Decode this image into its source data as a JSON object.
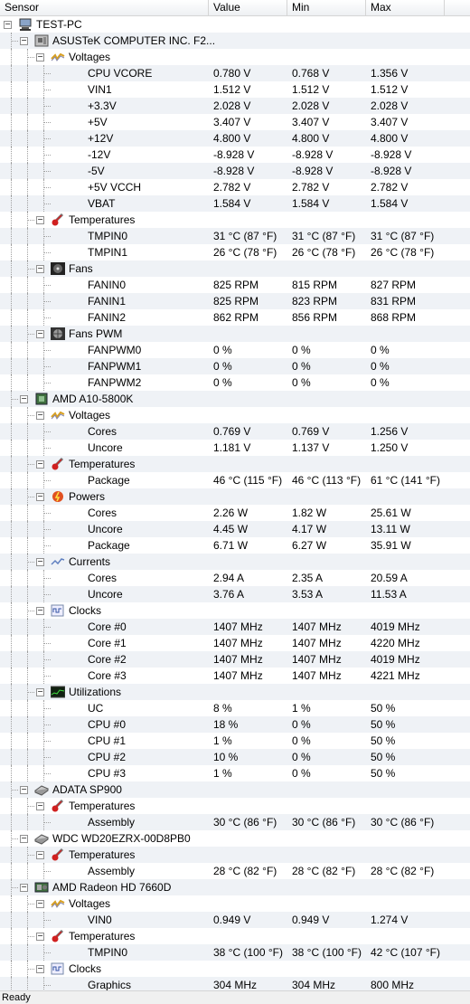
{
  "header": {
    "sensor": "Sensor",
    "value": "Value",
    "min": "Min",
    "max": "Max"
  },
  "rows": [
    {
      "level": 0,
      "label": "TEST-PC",
      "icon": "computer-icon",
      "exp": true
    },
    {
      "level": 1,
      "label": "ASUSTeK COMPUTER INC. F2...",
      "icon": "motherboard-icon",
      "exp": true
    },
    {
      "level": 2,
      "label": "Voltages",
      "icon": "voltage-icon",
      "exp": true
    },
    {
      "level": 3,
      "label": "CPU VCORE",
      "value": "0.780 V",
      "min": "0.768 V",
      "max": "1.356 V"
    },
    {
      "level": 3,
      "label": "VIN1",
      "value": "1.512 V",
      "min": "1.512 V",
      "max": "1.512 V"
    },
    {
      "level": 3,
      "label": "+3.3V",
      "value": "2.028 V",
      "min": "2.028 V",
      "max": "2.028 V"
    },
    {
      "level": 3,
      "label": "+5V",
      "value": "3.407 V",
      "min": "3.407 V",
      "max": "3.407 V"
    },
    {
      "level": 3,
      "label": "+12V",
      "value": "4.800 V",
      "min": "4.800 V",
      "max": "4.800 V"
    },
    {
      "level": 3,
      "label": "-12V",
      "value": "-8.928 V",
      "min": "-8.928 V",
      "max": "-8.928 V"
    },
    {
      "level": 3,
      "label": "-5V",
      "value": "-8.928 V",
      "min": "-8.928 V",
      "max": "-8.928 V"
    },
    {
      "level": 3,
      "label": "+5V VCCH",
      "value": "2.782 V",
      "min": "2.782 V",
      "max": "2.782 V"
    },
    {
      "level": 3,
      "label": "VBAT",
      "value": "1.584 V",
      "min": "1.584 V",
      "max": "1.584 V"
    },
    {
      "level": 2,
      "label": "Temperatures",
      "icon": "thermometer-icon",
      "exp": true
    },
    {
      "level": 3,
      "label": "TMPIN0",
      "value": "31 °C  (87 °F)",
      "min": "31 °C  (87 °F)",
      "max": "31 °C  (87 °F)"
    },
    {
      "level": 3,
      "label": "TMPIN1",
      "value": "26 °C  (78 °F)",
      "min": "26 °C  (78 °F)",
      "max": "26 °C  (78 °F)"
    },
    {
      "level": 2,
      "label": "Fans",
      "icon": "fan-icon",
      "exp": true
    },
    {
      "level": 3,
      "label": "FANIN0",
      "value": "825 RPM",
      "min": "815 RPM",
      "max": "827 RPM"
    },
    {
      "level": 3,
      "label": "FANIN1",
      "value": "825 RPM",
      "min": "823 RPM",
      "max": "831 RPM"
    },
    {
      "level": 3,
      "label": "FANIN2",
      "value": "862 RPM",
      "min": "856 RPM",
      "max": "868 RPM"
    },
    {
      "level": 2,
      "label": "Fans PWM",
      "icon": "fan-pwm-icon",
      "exp": true
    },
    {
      "level": 3,
      "label": "FANPWM0",
      "value": "0 %",
      "min": "0 %",
      "max": "0 %"
    },
    {
      "level": 3,
      "label": "FANPWM1",
      "value": "0 %",
      "min": "0 %",
      "max": "0 %"
    },
    {
      "level": 3,
      "label": "FANPWM2",
      "value": "0 %",
      "min": "0 %",
      "max": "0 %"
    },
    {
      "level": 1,
      "label": "AMD A10-5800K",
      "icon": "cpu-icon",
      "exp": true
    },
    {
      "level": 2,
      "label": "Voltages",
      "icon": "voltage-icon",
      "exp": true
    },
    {
      "level": 3,
      "label": "Cores",
      "value": "0.769 V",
      "min": "0.769 V",
      "max": "1.256 V"
    },
    {
      "level": 3,
      "label": "Uncore",
      "value": "1.181 V",
      "min": "1.137 V",
      "max": "1.250 V"
    },
    {
      "level": 2,
      "label": "Temperatures",
      "icon": "thermometer-icon",
      "exp": true
    },
    {
      "level": 3,
      "label": "Package",
      "value": "46 °C  (115 °F)",
      "min": "46 °C  (113 °F)",
      "max": "61 °C  (141 °F)"
    },
    {
      "level": 2,
      "label": "Powers",
      "icon": "power-icon",
      "exp": true
    },
    {
      "level": 3,
      "label": "Cores",
      "value": "2.26 W",
      "min": "1.82 W",
      "max": "25.61 W"
    },
    {
      "level": 3,
      "label": "Uncore",
      "value": "4.45 W",
      "min": "4.17 W",
      "max": "13.11 W"
    },
    {
      "level": 3,
      "label": "Package",
      "value": "6.71 W",
      "min": "6.27 W",
      "max": "35.91 W"
    },
    {
      "level": 2,
      "label": "Currents",
      "icon": "current-icon",
      "exp": true
    },
    {
      "level": 3,
      "label": "Cores",
      "value": "2.94 A",
      "min": "2.35 A",
      "max": "20.59 A"
    },
    {
      "level": 3,
      "label": "Uncore",
      "value": "3.76 A",
      "min": "3.53 A",
      "max": "11.53 A"
    },
    {
      "level": 2,
      "label": "Clocks",
      "icon": "clock-icon",
      "exp": true
    },
    {
      "level": 3,
      "label": "Core #0",
      "value": "1407 MHz",
      "min": "1407 MHz",
      "max": "4019 MHz"
    },
    {
      "level": 3,
      "label": "Core #1",
      "value": "1407 MHz",
      "min": "1407 MHz",
      "max": "4220 MHz"
    },
    {
      "level": 3,
      "label": "Core #2",
      "value": "1407 MHz",
      "min": "1407 MHz",
      "max": "4019 MHz"
    },
    {
      "level": 3,
      "label": "Core #3",
      "value": "1407 MHz",
      "min": "1407 MHz",
      "max": "4221 MHz"
    },
    {
      "level": 2,
      "label": "Utilizations",
      "icon": "utilization-icon",
      "exp": true
    },
    {
      "level": 3,
      "label": "UC",
      "value": "8 %",
      "min": "1 %",
      "max": "50 %"
    },
    {
      "level": 3,
      "label": "CPU #0",
      "value": "18 %",
      "min": "0 %",
      "max": "50 %"
    },
    {
      "level": 3,
      "label": "CPU #1",
      "value": "1 %",
      "min": "0 %",
      "max": "50 %"
    },
    {
      "level": 3,
      "label": "CPU #2",
      "value": "10 %",
      "min": "0 %",
      "max": "50 %"
    },
    {
      "level": 3,
      "label": "CPU #3",
      "value": "1 %",
      "min": "0 %",
      "max": "50 %"
    },
    {
      "level": 1,
      "label": "ADATA SP900",
      "icon": "disk-icon",
      "exp": true
    },
    {
      "level": 2,
      "label": "Temperatures",
      "icon": "thermometer-icon",
      "exp": true
    },
    {
      "level": 3,
      "label": "Assembly",
      "value": "30 °C  (86 °F)",
      "min": "30 °C  (86 °F)",
      "max": "30 °C  (86 °F)"
    },
    {
      "level": 1,
      "label": "WDC WD20EZRX-00D8PB0",
      "icon": "disk-icon",
      "exp": true
    },
    {
      "level": 2,
      "label": "Temperatures",
      "icon": "thermometer-icon",
      "exp": true
    },
    {
      "level": 3,
      "label": "Assembly",
      "value": "28 °C  (82 °F)",
      "min": "28 °C  (82 °F)",
      "max": "28 °C  (82 °F)"
    },
    {
      "level": 1,
      "label": "AMD Radeon HD 7660D",
      "icon": "gpu-icon",
      "exp": true
    },
    {
      "level": 2,
      "label": "Voltages",
      "icon": "voltage-icon",
      "exp": true
    },
    {
      "level": 3,
      "label": "VIN0",
      "value": "0.949 V",
      "min": "0.949 V",
      "max": "1.274 V"
    },
    {
      "level": 2,
      "label": "Temperatures",
      "icon": "thermometer-icon",
      "exp": true
    },
    {
      "level": 3,
      "label": "TMPIN0",
      "value": "38 °C  (100 °F)",
      "min": "38 °C  (100 °F)",
      "max": "42 °C  (107 °F)"
    },
    {
      "level": 2,
      "label": "Clocks",
      "icon": "clock-icon",
      "exp": true
    },
    {
      "level": 3,
      "label": "Graphics",
      "value": "304 MHz",
      "min": "304 MHz",
      "max": "800 MHz"
    }
  ],
  "status": "Ready"
}
